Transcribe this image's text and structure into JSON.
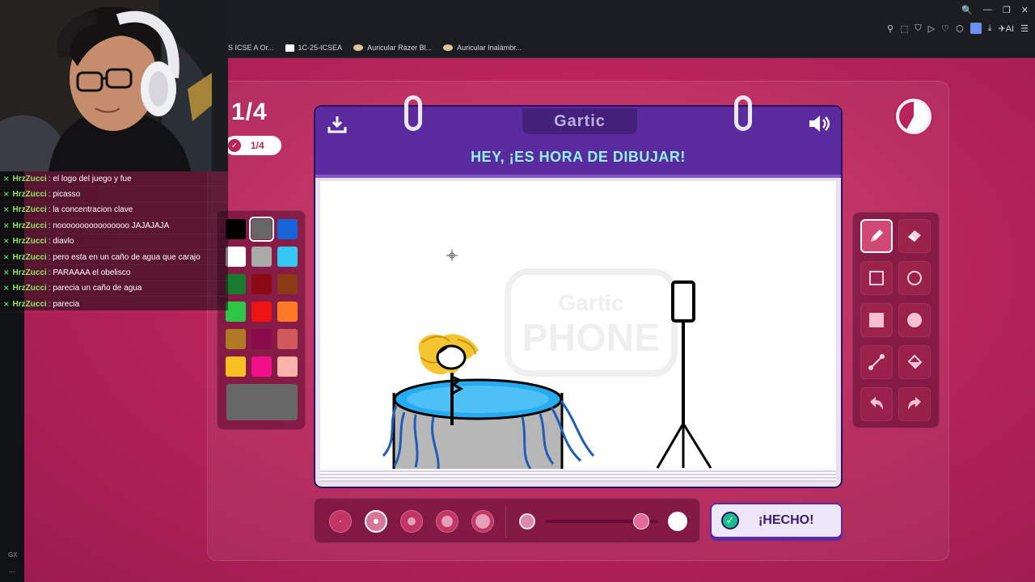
{
  "browser": {
    "bookmarks": [
      {
        "label": "S ICSE A Or..."
      },
      {
        "label": "1C-25-ICSEA"
      },
      {
        "label": "Auricular Razer Bl..."
      },
      {
        "label": "Auricular Inalámbr..."
      }
    ],
    "ai_label": "AI",
    "sidebar_label": "GX",
    "sidebar_more": "..."
  },
  "stream_chat": {
    "messages": [
      {
        "user": "HrzZucci",
        "text": ": el logo del juego y fue"
      },
      {
        "user": "HrzZucci",
        "text": ": picasso"
      },
      {
        "user": "HrzZucci",
        "text": ": la concentracion clave"
      },
      {
        "user": "HrzZucci",
        "text": ": noooooooooooooooo JAJAJAJA"
      },
      {
        "user": "HrzZucci",
        "text": ": diavlo"
      },
      {
        "user": "HrzZucci",
        "text": ": pero esta en un caño de agua que carajo"
      },
      {
        "user": "HrzZucci",
        "text": ": PARAAAA el obelisco"
      },
      {
        "user": "HrzZucci",
        "text": ": parecia un caño de agua"
      },
      {
        "user": "HrzZucci",
        "text": ": parecia"
      }
    ]
  },
  "game": {
    "logo": "Gartic",
    "title": "HEY, ¡ES HORA DE DIBUJAR!",
    "round_big": "1/4",
    "round_pill": "1/4",
    "watermark_top": "Gartic",
    "watermark_bottom": "PHONE",
    "done_label": "¡HECHO!",
    "timer_remaining_fraction": 0.58,
    "palette": {
      "colors": [
        "#000000",
        "#666666",
        "#1565d8",
        "#ffffff",
        "#aaaaaa",
        "#35c8f2",
        "#177a2c",
        "#8c0a14",
        "#8a3a14",
        "#2ec645",
        "#ee1414",
        "#ff7a24",
        "#b07a24",
        "#8a0a4a",
        "#cf5a5e",
        "#f8bf22",
        "#f2108a",
        "#f9b2a8"
      ],
      "selected": "#666666",
      "current": "#666666"
    },
    "tools": [
      "pencil-icon",
      "eraser-icon",
      "rect-outline-icon",
      "circle-outline-icon",
      "rect-fill-icon",
      "circle-fill-icon",
      "line-icon",
      "bucket-icon",
      "undo-icon",
      "redo-icon"
    ],
    "active_tool": "pencil-icon",
    "brush_sizes": [
      2,
      6,
      10,
      14,
      18
    ],
    "selected_brush_index": 1,
    "opacity_value": 0.85,
    "accent_colors": {
      "page": "#b8245a",
      "book_header": "#5b2a9e",
      "title": "#8df4e7",
      "done_check": "#16c08a"
    }
  }
}
